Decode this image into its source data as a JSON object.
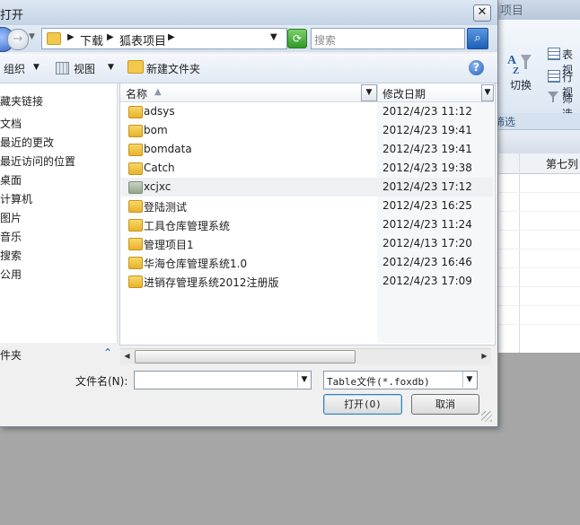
{
  "background_app": {
    "title_fragment": "项目",
    "ribbon": {
      "switch_label": "切换",
      "items": [
        "表视",
        "行视",
        "筛选"
      ],
      "group_label": "筛选"
    },
    "column_header": "第七列"
  },
  "dialog": {
    "title": "打开",
    "close_glyph": "✕",
    "address": {
      "crumbs": [
        "下载",
        "狐表项目"
      ]
    },
    "search": {
      "placeholder": "搜索"
    },
    "toolbar": {
      "organize": "组织",
      "view": "视图",
      "new_folder": "新建文件夹"
    },
    "nav_pane": {
      "items": [
        "藏夹链接",
        "文档",
        "最近的更改",
        "最近访问的位置",
        "桌面",
        "计算机",
        "图片",
        "音乐",
        "搜索",
        "公用"
      ],
      "footer": "件夹"
    },
    "columns": {
      "name": "名称",
      "modified": "修改日期"
    },
    "files": [
      {
        "name": "adsys",
        "date": "2012/4/23 11:12"
      },
      {
        "name": "bom",
        "date": "2012/4/23 19:41"
      },
      {
        "name": "bomdata",
        "date": "2012/4/23 19:41"
      },
      {
        "name": "Catch",
        "date": "2012/4/23 19:38"
      },
      {
        "name": "xcjxc",
        "date": "2012/4/23 17:12"
      },
      {
        "name": "登陆测试",
        "date": "2012/4/23 16:25"
      },
      {
        "name": "工具仓库管理系统",
        "date": "2012/4/23 11:24"
      },
      {
        "name": "管理项目1",
        "date": "2012/4/13 17:20"
      },
      {
        "name": "华海仓库管理系统1.0",
        "date": "2012/4/23 16:46"
      },
      {
        "name": "进销存管理系统2012注册版",
        "date": "2012/4/23 17:09"
      }
    ],
    "filename": {
      "label": "文件名(N):",
      "value": ""
    },
    "filetype": {
      "selected": "Table文件(*.foxdb)"
    },
    "buttons": {
      "open": "打开(O)",
      "cancel": "取消"
    }
  }
}
